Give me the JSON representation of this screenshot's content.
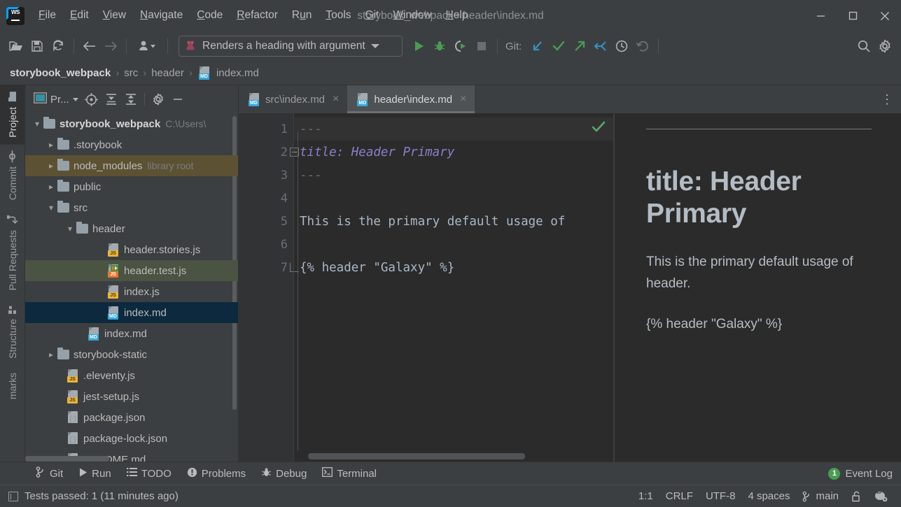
{
  "window": {
    "title": "storybook_webpack - header\\index.md",
    "app_icon": "webstorm-logo-icon",
    "controls": {
      "minimize": "minimize-button",
      "maximize": "maximize-button",
      "close": "close-button"
    }
  },
  "menubar": {
    "items": [
      {
        "label": "File",
        "mnemonic": "F"
      },
      {
        "label": "Edit",
        "mnemonic": "E"
      },
      {
        "label": "View",
        "mnemonic": "V"
      },
      {
        "label": "Navigate",
        "mnemonic": "N"
      },
      {
        "label": "Code",
        "mnemonic": "C"
      },
      {
        "label": "Refactor",
        "mnemonic": "R"
      },
      {
        "label": "Run",
        "mnemonic": "u"
      },
      {
        "label": "Tools",
        "mnemonic": "T"
      },
      {
        "label": "Git",
        "mnemonic": "G"
      },
      {
        "label": "Window",
        "mnemonic": "W"
      },
      {
        "label": "Help",
        "mnemonic": "H"
      }
    ]
  },
  "toolbar": {
    "open_label": "open-project",
    "save_label": "save-all",
    "sync_label": "reload-from-disk",
    "back_label": "navigate-back",
    "forward_label": "navigate-forward",
    "profile_label": "user-profile",
    "run_config": {
      "name": "Renders a heading with argument",
      "icon": "jest-icon"
    },
    "run_label": "run",
    "debug_label": "debug",
    "coverage_label": "run-with-coverage",
    "stop_label": "stop",
    "git_label": "Git:",
    "git_update_label": "update-project",
    "git_commit_label": "commit",
    "git_push_label": "push",
    "git_pull_label": "pull",
    "git_history_label": "show-history",
    "git_rollback_label": "rollback",
    "search_label": "search-everywhere",
    "settings_label": "settings"
  },
  "breadcrumb": {
    "items": [
      {
        "label": "storybook_webpack",
        "type": "project"
      },
      {
        "label": "src",
        "type": "folder"
      },
      {
        "label": "header",
        "type": "folder"
      },
      {
        "label": "index.md",
        "type": "file",
        "icon": "md-file-icon"
      }
    ],
    "separator": "›"
  },
  "left_toolstrip": {
    "tabs": [
      {
        "label": "Project",
        "icon": "folder-icon",
        "active": true
      },
      {
        "label": "Commit",
        "icon": "commit-icon",
        "active": false
      },
      {
        "label": "Pull Requests",
        "icon": "pull-request-icon",
        "active": false
      },
      {
        "label": "Structure",
        "icon": "structure-icon",
        "active": false
      },
      {
        "label": "marks",
        "icon": "bookmarks-icon",
        "active": false
      }
    ]
  },
  "project_panel": {
    "title": "Pr...",
    "buttons": [
      {
        "name": "select-opened-file",
        "icon": "crosshair-icon"
      },
      {
        "name": "expand-all",
        "icon": "expand-all-icon"
      },
      {
        "name": "collapse-all",
        "icon": "collapse-all-icon"
      },
      {
        "name": "panel-settings",
        "icon": "gear-icon"
      },
      {
        "name": "hide-panel",
        "icon": "minus-icon"
      }
    ],
    "tree": [
      {
        "label": "storybook_webpack",
        "hint": "C:\\Users\\",
        "type": "project-root",
        "indent": 0,
        "arrow": "down",
        "bold": true,
        "highlight": "none"
      },
      {
        "label": ".storybook",
        "hint": "",
        "type": "folder",
        "indent": 1,
        "arrow": "right",
        "bold": false,
        "highlight": "none"
      },
      {
        "label": "node_modules",
        "hint": "library root",
        "type": "folder",
        "indent": 1,
        "arrow": "right",
        "bold": false,
        "highlight": "brown"
      },
      {
        "label": "public",
        "hint": "",
        "type": "folder",
        "indent": 1,
        "arrow": "right",
        "bold": false,
        "highlight": "none"
      },
      {
        "label": "src",
        "hint": "",
        "type": "folder",
        "indent": 1,
        "arrow": "down",
        "bold": false,
        "highlight": "none"
      },
      {
        "label": "header",
        "hint": "",
        "type": "folder",
        "indent": 2,
        "arrow": "down",
        "bold": false,
        "highlight": "none"
      },
      {
        "label": "header.stories.js",
        "hint": "",
        "type": "js",
        "indent": 3,
        "arrow": "none",
        "bold": false,
        "highlight": "none"
      },
      {
        "label": "header.test.js",
        "hint": "",
        "type": "js-test",
        "indent": 3,
        "arrow": "none",
        "bold": false,
        "highlight": "green"
      },
      {
        "label": "index.js",
        "hint": "",
        "type": "js",
        "indent": 3,
        "arrow": "none",
        "bold": false,
        "highlight": "none"
      },
      {
        "label": "index.md",
        "hint": "",
        "type": "md",
        "indent": 3,
        "arrow": "none",
        "bold": false,
        "highlight": "selected"
      },
      {
        "label": "index.md",
        "hint": "",
        "type": "md",
        "indent": 2,
        "arrow": "none",
        "bold": false,
        "highlight": "none"
      },
      {
        "label": "storybook-static",
        "hint": "",
        "type": "folder",
        "indent": 1,
        "arrow": "right",
        "bold": false,
        "highlight": "none"
      },
      {
        "label": ".eleventy.js",
        "hint": "",
        "type": "js",
        "indent": 1,
        "arrow": "none",
        "bold": false,
        "highlight": "none"
      },
      {
        "label": "jest-setup.js",
        "hint": "",
        "type": "js",
        "indent": 1,
        "arrow": "none",
        "bold": false,
        "highlight": "none"
      },
      {
        "label": "package.json",
        "hint": "",
        "type": "json",
        "indent": 1,
        "arrow": "none",
        "bold": false,
        "highlight": "none"
      },
      {
        "label": "package-lock.json",
        "hint": "",
        "type": "json",
        "indent": 1,
        "arrow": "none",
        "bold": false,
        "highlight": "none"
      },
      {
        "label": "README.md",
        "hint": "",
        "type": "md",
        "indent": 1,
        "arrow": "none",
        "bold": false,
        "highlight": "none"
      }
    ]
  },
  "editor": {
    "tabs": [
      {
        "label": "src\\index.md",
        "icon": "md-file-icon",
        "active": false,
        "close": "×"
      },
      {
        "label": "header\\index.md",
        "icon": "md-file-icon",
        "active": true,
        "close": "×"
      }
    ],
    "overflow_label": "more-tabs",
    "inspection_status": "ok-check-icon",
    "lines": [
      {
        "num": "1",
        "text": "---",
        "token": "hr",
        "fold": "none",
        "active": true
      },
      {
        "num": "2",
        "text": "title: Header Primary",
        "token": "yaml-key",
        "fold": "start",
        "active": false
      },
      {
        "num": "3",
        "text": "---",
        "token": "hr",
        "fold": "none",
        "active": false
      },
      {
        "num": "4",
        "text": "",
        "token": "plain",
        "fold": "none",
        "active": false
      },
      {
        "num": "5",
        "text": "This is the primary default usage of",
        "token": "plain",
        "fold": "none",
        "active": false
      },
      {
        "num": "6",
        "text": "",
        "token": "plain",
        "fold": "none",
        "active": false
      },
      {
        "num": "7",
        "text": "{% header \"Galaxy\" %}",
        "token": "plain",
        "fold": "end",
        "active": false
      }
    ]
  },
  "preview": {
    "heading": "title: Header Primary",
    "paragraphs": [
      "This is the primary default usage of header.",
      "{% header \"Galaxy\" %}"
    ]
  },
  "bottom_bar": {
    "items": [
      {
        "label": "Git",
        "icon": "git-branch-icon"
      },
      {
        "label": "Run",
        "icon": "run-icon"
      },
      {
        "label": "TODO",
        "icon": "todo-icon"
      },
      {
        "label": "Problems",
        "icon": "problems-icon"
      },
      {
        "label": "Debug",
        "icon": "debug-icon"
      },
      {
        "label": "Terminal",
        "icon": "terminal-icon"
      }
    ],
    "event_log": {
      "label": "Event Log",
      "count": "1"
    }
  },
  "status_bar": {
    "message": "Tests passed: 1 (11 minutes ago)",
    "message_icon": "ide-window-icon",
    "caret": "1:1",
    "line_separator": "CRLF",
    "encoding": "UTF-8",
    "indent": "4 spaces",
    "branch": "main",
    "branch_icon": "git-branch-icon",
    "lock_icon": "unlocked-icon",
    "inspection_icon": "inspection-settings-icon"
  },
  "colors": {
    "chrome": "#3c3f41",
    "editor_bg": "#2b2b2b",
    "gutter_bg": "#313335",
    "accent_blue": "#38a8d8",
    "selection_blue": "#0d293e",
    "test_green": "#4b5343",
    "library_brown": "#5c5233",
    "run_green": "#499c54",
    "yaml_key": "#8a7fc8",
    "text": "#bbbbbb"
  }
}
